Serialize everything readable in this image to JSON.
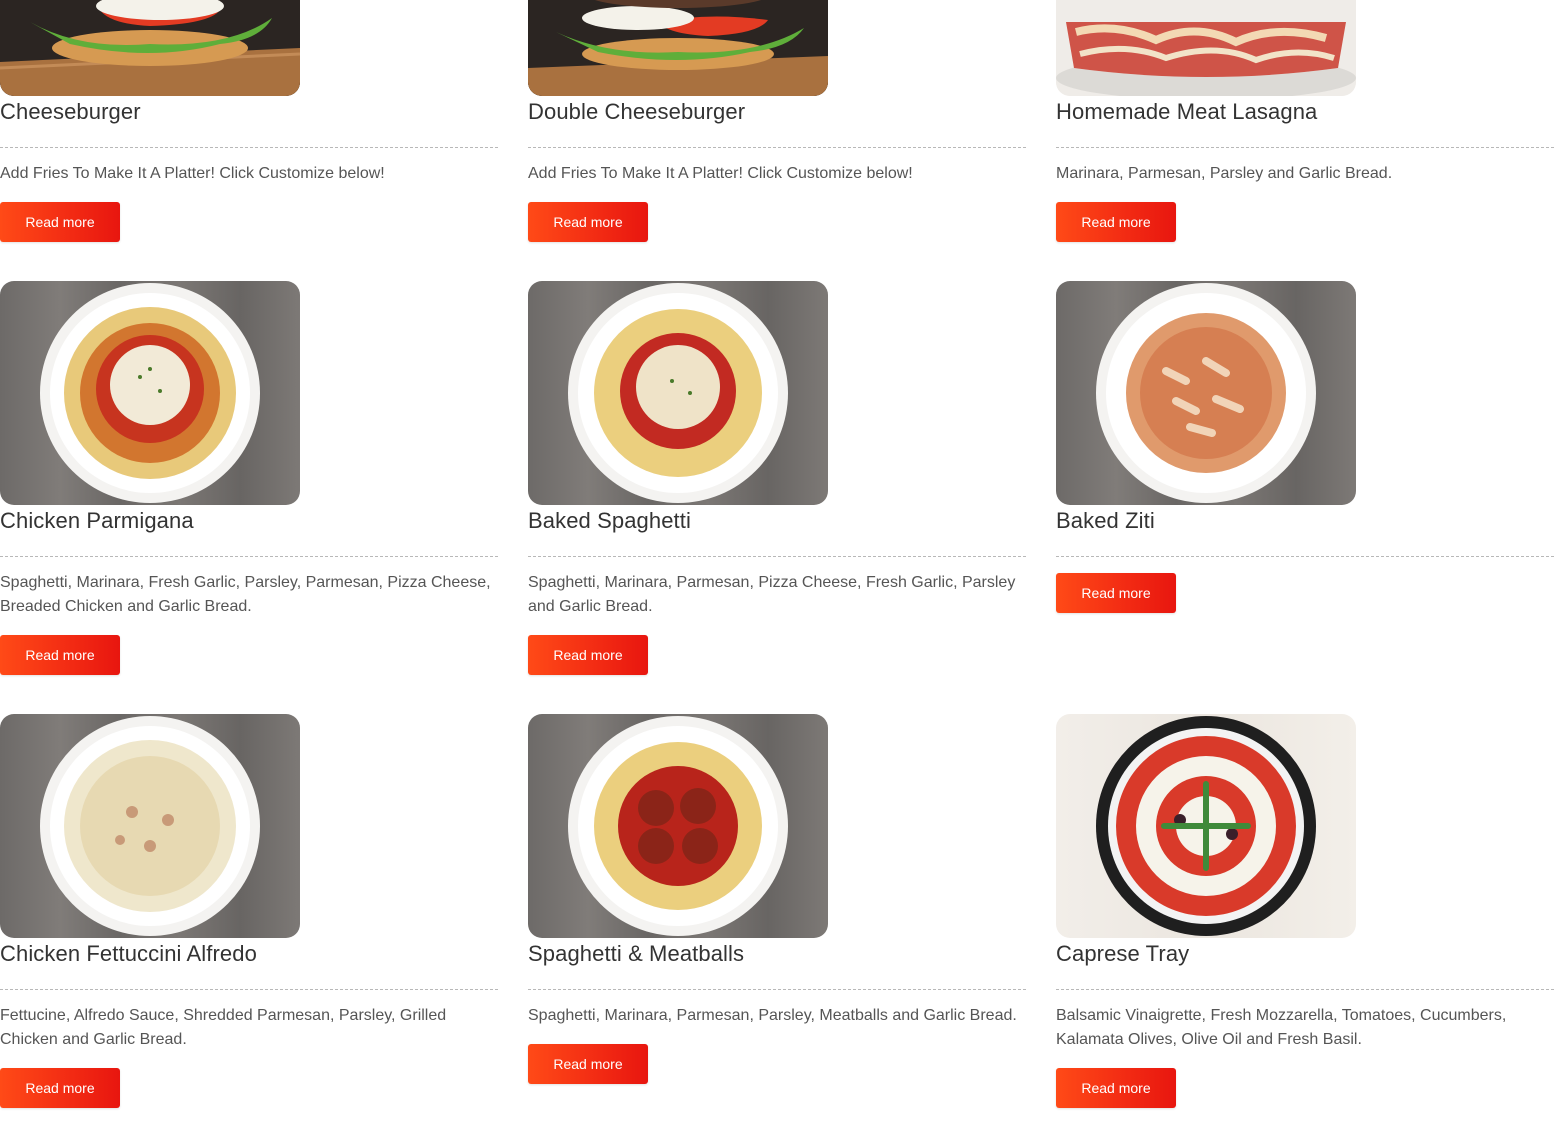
{
  "menu": {
    "items": [
      {
        "name": "Cheeseburger",
        "description": "Add Fries To Make It A Platter! Click Customize below!",
        "button": "Read more",
        "image": "cheeseburger-photo"
      },
      {
        "name": "Double Cheeseburger",
        "description": "Add Fries To Make It A Platter! Click Customize below!",
        "button": "Read more",
        "image": "double-cheeseburger-photo"
      },
      {
        "name": "Homemade Meat Lasagna",
        "description": "Marinara, Parmesan, Parsley and Garlic Bread.",
        "button": "Read more",
        "image": "lasagna-photo"
      },
      {
        "name": "Chicken Parmigana",
        "description": "Spaghetti, Marinara, Fresh Garlic, Parsley, Parmesan, Pizza Cheese, Breaded Chicken and Garlic Bread.",
        "button": "Read more",
        "image": "chicken-parmigana-photo"
      },
      {
        "name": "Baked Spaghetti",
        "description": "Spaghetti, Marinara, Parmesan, Pizza Cheese, Fresh Garlic, Parsley and Garlic Bread.",
        "button": "Read more",
        "image": "baked-spaghetti-photo"
      },
      {
        "name": "Baked Ziti",
        "description": "",
        "button": "Read more",
        "image": "baked-ziti-photo"
      },
      {
        "name": "Chicken Fettuccini Alfredo",
        "description": "Fettucine, Alfredo Sauce, Shredded Parmesan, Parsley, Grilled Chicken and Garlic Bread.",
        "button": "Read more",
        "image": "fettuccini-alfredo-photo"
      },
      {
        "name": "Spaghetti & Meatballs",
        "description": "Spaghetti, Marinara, Parmesan, Parsley, Meatballs and Garlic Bread.",
        "button": "Read more",
        "image": "spaghetti-meatballs-photo"
      },
      {
        "name": "Caprese Tray",
        "description": "Balsamic Vinaigrette, Fresh Mozzarella, Tomatoes, Cucumbers, Kalamata Olives, Olive Oil and Fresh Basil.",
        "button": "Read more",
        "image": "caprese-tray-photo"
      }
    ]
  },
  "colors": {
    "button": "#f22a13",
    "title": "#333333",
    "text": "#555555"
  }
}
